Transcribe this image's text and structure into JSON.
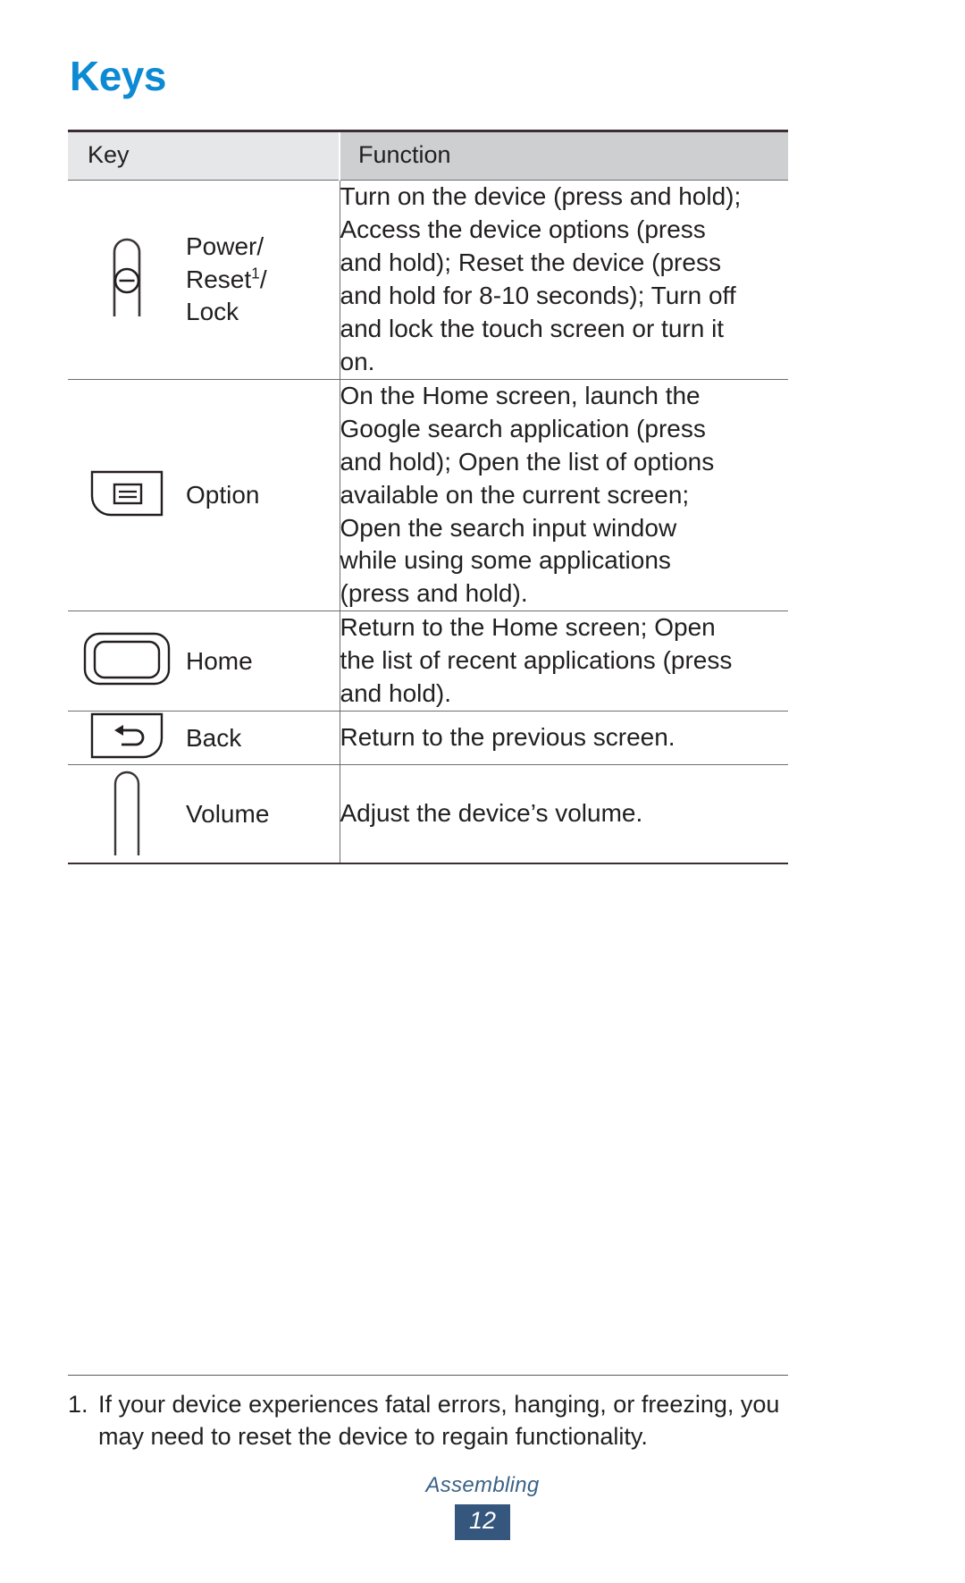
{
  "document": {
    "title": "Keys",
    "title_color": "#0d8ad4"
  },
  "table": {
    "headers": {
      "key": "Key",
      "function": "Function"
    },
    "rows": [
      {
        "icon": "power-key-icon",
        "label_line1": "Power/",
        "label_line2": "Reset",
        "label_footnote_mark": "1",
        "label_line2_suffix": "/",
        "label_line3": "Lock",
        "function_lines": [
          "Turn on the device (press and hold);",
          "Access the device options (press",
          "and hold); Reset the device (press",
          "and hold for 8-10 seconds); Turn off",
          "and lock the touch screen or turn it",
          "on."
        ]
      },
      {
        "icon": "option-key-icon",
        "label_line1": "Option",
        "function_lines": [
          "On the Home screen, launch the",
          "Google search application (press",
          "and hold); Open the list of options",
          "available on the current screen;",
          "Open the search input window",
          "while using some applications",
          "(press and hold)."
        ]
      },
      {
        "icon": "home-key-icon",
        "label_line1": "Home",
        "function_lines": [
          "Return to the Home screen; Open",
          "the list of recent applications (press",
          "and hold)."
        ]
      },
      {
        "icon": "back-key-icon",
        "label_line1": "Back",
        "function_lines": [
          "Return to the previous screen."
        ]
      },
      {
        "icon": "volume-key-icon",
        "label_line1": "Volume",
        "function_lines": [
          "Adjust the device’s volume."
        ]
      }
    ]
  },
  "footnote": {
    "number": "1.",
    "line1": "If your device experiences fatal errors, hanging, or freezing, you",
    "line2": "may need to reset the device to regain functionality."
  },
  "footer": {
    "section": "Assembling",
    "page_number": "12",
    "page_box_color": "#36577d"
  }
}
